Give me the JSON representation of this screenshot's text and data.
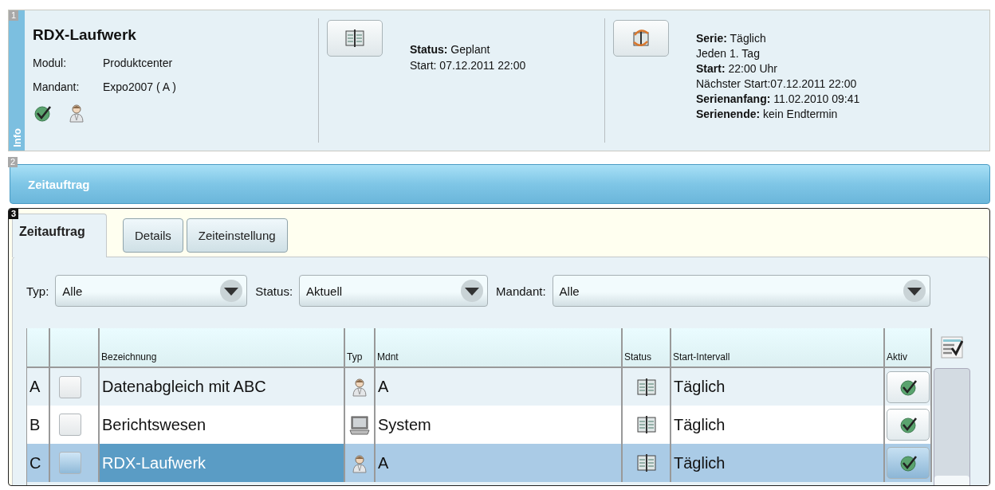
{
  "info_panel": {
    "badge": "1",
    "side_label": "Info",
    "title": "RDX-Laufwerk",
    "fields": [
      {
        "label": "Modul:",
        "value": "Produktcenter"
      },
      {
        "label": "Mandant:",
        "value": "Expo2007 ( A )"
      }
    ],
    "status_lines": [
      "**Status:** Geplant",
      "Start: 07.12.2011 22:00"
    ],
    "series_lines": [
      "**Serie:** Täglich",
      "Jeden 1. Tag",
      "**Start:** 22:00 Uhr",
      "Nächster Start:07.12.2011 22:00",
      "**Serienanfang:** 11.02.2010 09:41",
      "**Serienende:** kein Endtermin"
    ]
  },
  "title_bar": {
    "badge": "2",
    "title": "Zeitauftrag"
  },
  "main_panel": {
    "badge": "3",
    "tabs": [
      {
        "label": "Zeitauftrag",
        "selected": true
      },
      {
        "label": "Details",
        "selected": false
      },
      {
        "label": "Zeiteinstellung",
        "selected": false
      }
    ],
    "filters": [
      {
        "label": "Typ:",
        "value": "Alle"
      },
      {
        "label": "Status:",
        "value": "Aktuell"
      },
      {
        "label": "Mandant:",
        "value": "Alle"
      }
    ],
    "table": {
      "columns": [
        "Bezeichnung",
        "Typ",
        "Mdnt",
        "Status",
        "Start-Intervall",
        "Aktiv"
      ],
      "rows": [
        {
          "row_label": "A",
          "checked": false,
          "bezeichnung": "Datenabgleich mit ABC",
          "kind": "person",
          "mdnt": "A",
          "start_intervall": "Täglich",
          "aktiv": true,
          "selected": false
        },
        {
          "row_label": "B",
          "checked": false,
          "bezeichnung": "Berichtswesen",
          "kind": "computer",
          "mdnt": "System",
          "start_intervall": "Täglich",
          "aktiv": true,
          "selected": false
        },
        {
          "row_label": "C",
          "checked": false,
          "bezeichnung": "RDX-Laufwerk",
          "kind": "person",
          "mdnt": "A",
          "start_intervall": "Täglich",
          "aktiv": true,
          "selected": true
        }
      ]
    }
  }
}
